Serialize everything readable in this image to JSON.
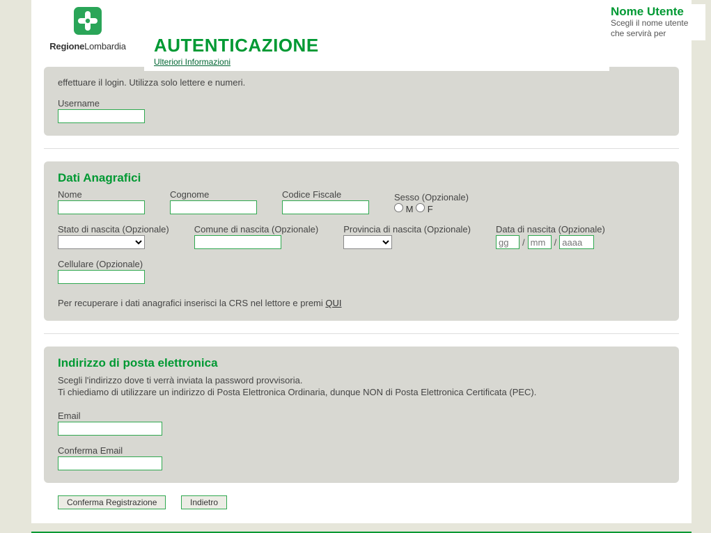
{
  "header": {
    "brand1": "Regione",
    "brand2": "Lombardia",
    "title": "AUTENTICAZIONE",
    "sublink": "Ulteriori Informazioni"
  },
  "nomeutente": {
    "title": "Nome Utente",
    "desc_prefix": "Scegli il nome utente che servirà per",
    "desc_rest": "effettuare il login. Utilizza solo lettere e numeri.",
    "username_label": "Username"
  },
  "anagrafici": {
    "title": "Dati Anagrafici",
    "nome": "Nome",
    "cognome": "Cognome",
    "cf": "Codice Fiscale",
    "sesso": "Sesso (Opzionale)",
    "sesso_m": "M",
    "sesso_f": "F",
    "stato": "Stato di nascita (Opzionale)",
    "comune": "Comune di nascita (Opzionale)",
    "provincia": "Provincia di nascita (Opzionale)",
    "data": "Data di nascita (Opzionale)",
    "gg": "gg",
    "mm": "mm",
    "aaaa": "aaaa",
    "cell": "Cellulare (Opzionale)",
    "crs_prefix": "Per recuperare i dati anagrafici inserisci la CRS nel lettore e premi ",
    "crs_link": "QUI"
  },
  "email": {
    "title": "Indirizzo di posta elettronica",
    "line1": "Scegli l'indirizzo dove ti verrà inviata la password provvisoria.",
    "line2": "Ti chiediamo di utilizzare un indirizzo di Posta Elettronica Ordinaria, dunque NON di Posta Elettronica Certificata (PEC).",
    "email_label": "Email",
    "confirm_label": "Conferma Email"
  },
  "buttons": {
    "confirm": "Conferma Registrazione",
    "back": "Indietro"
  }
}
